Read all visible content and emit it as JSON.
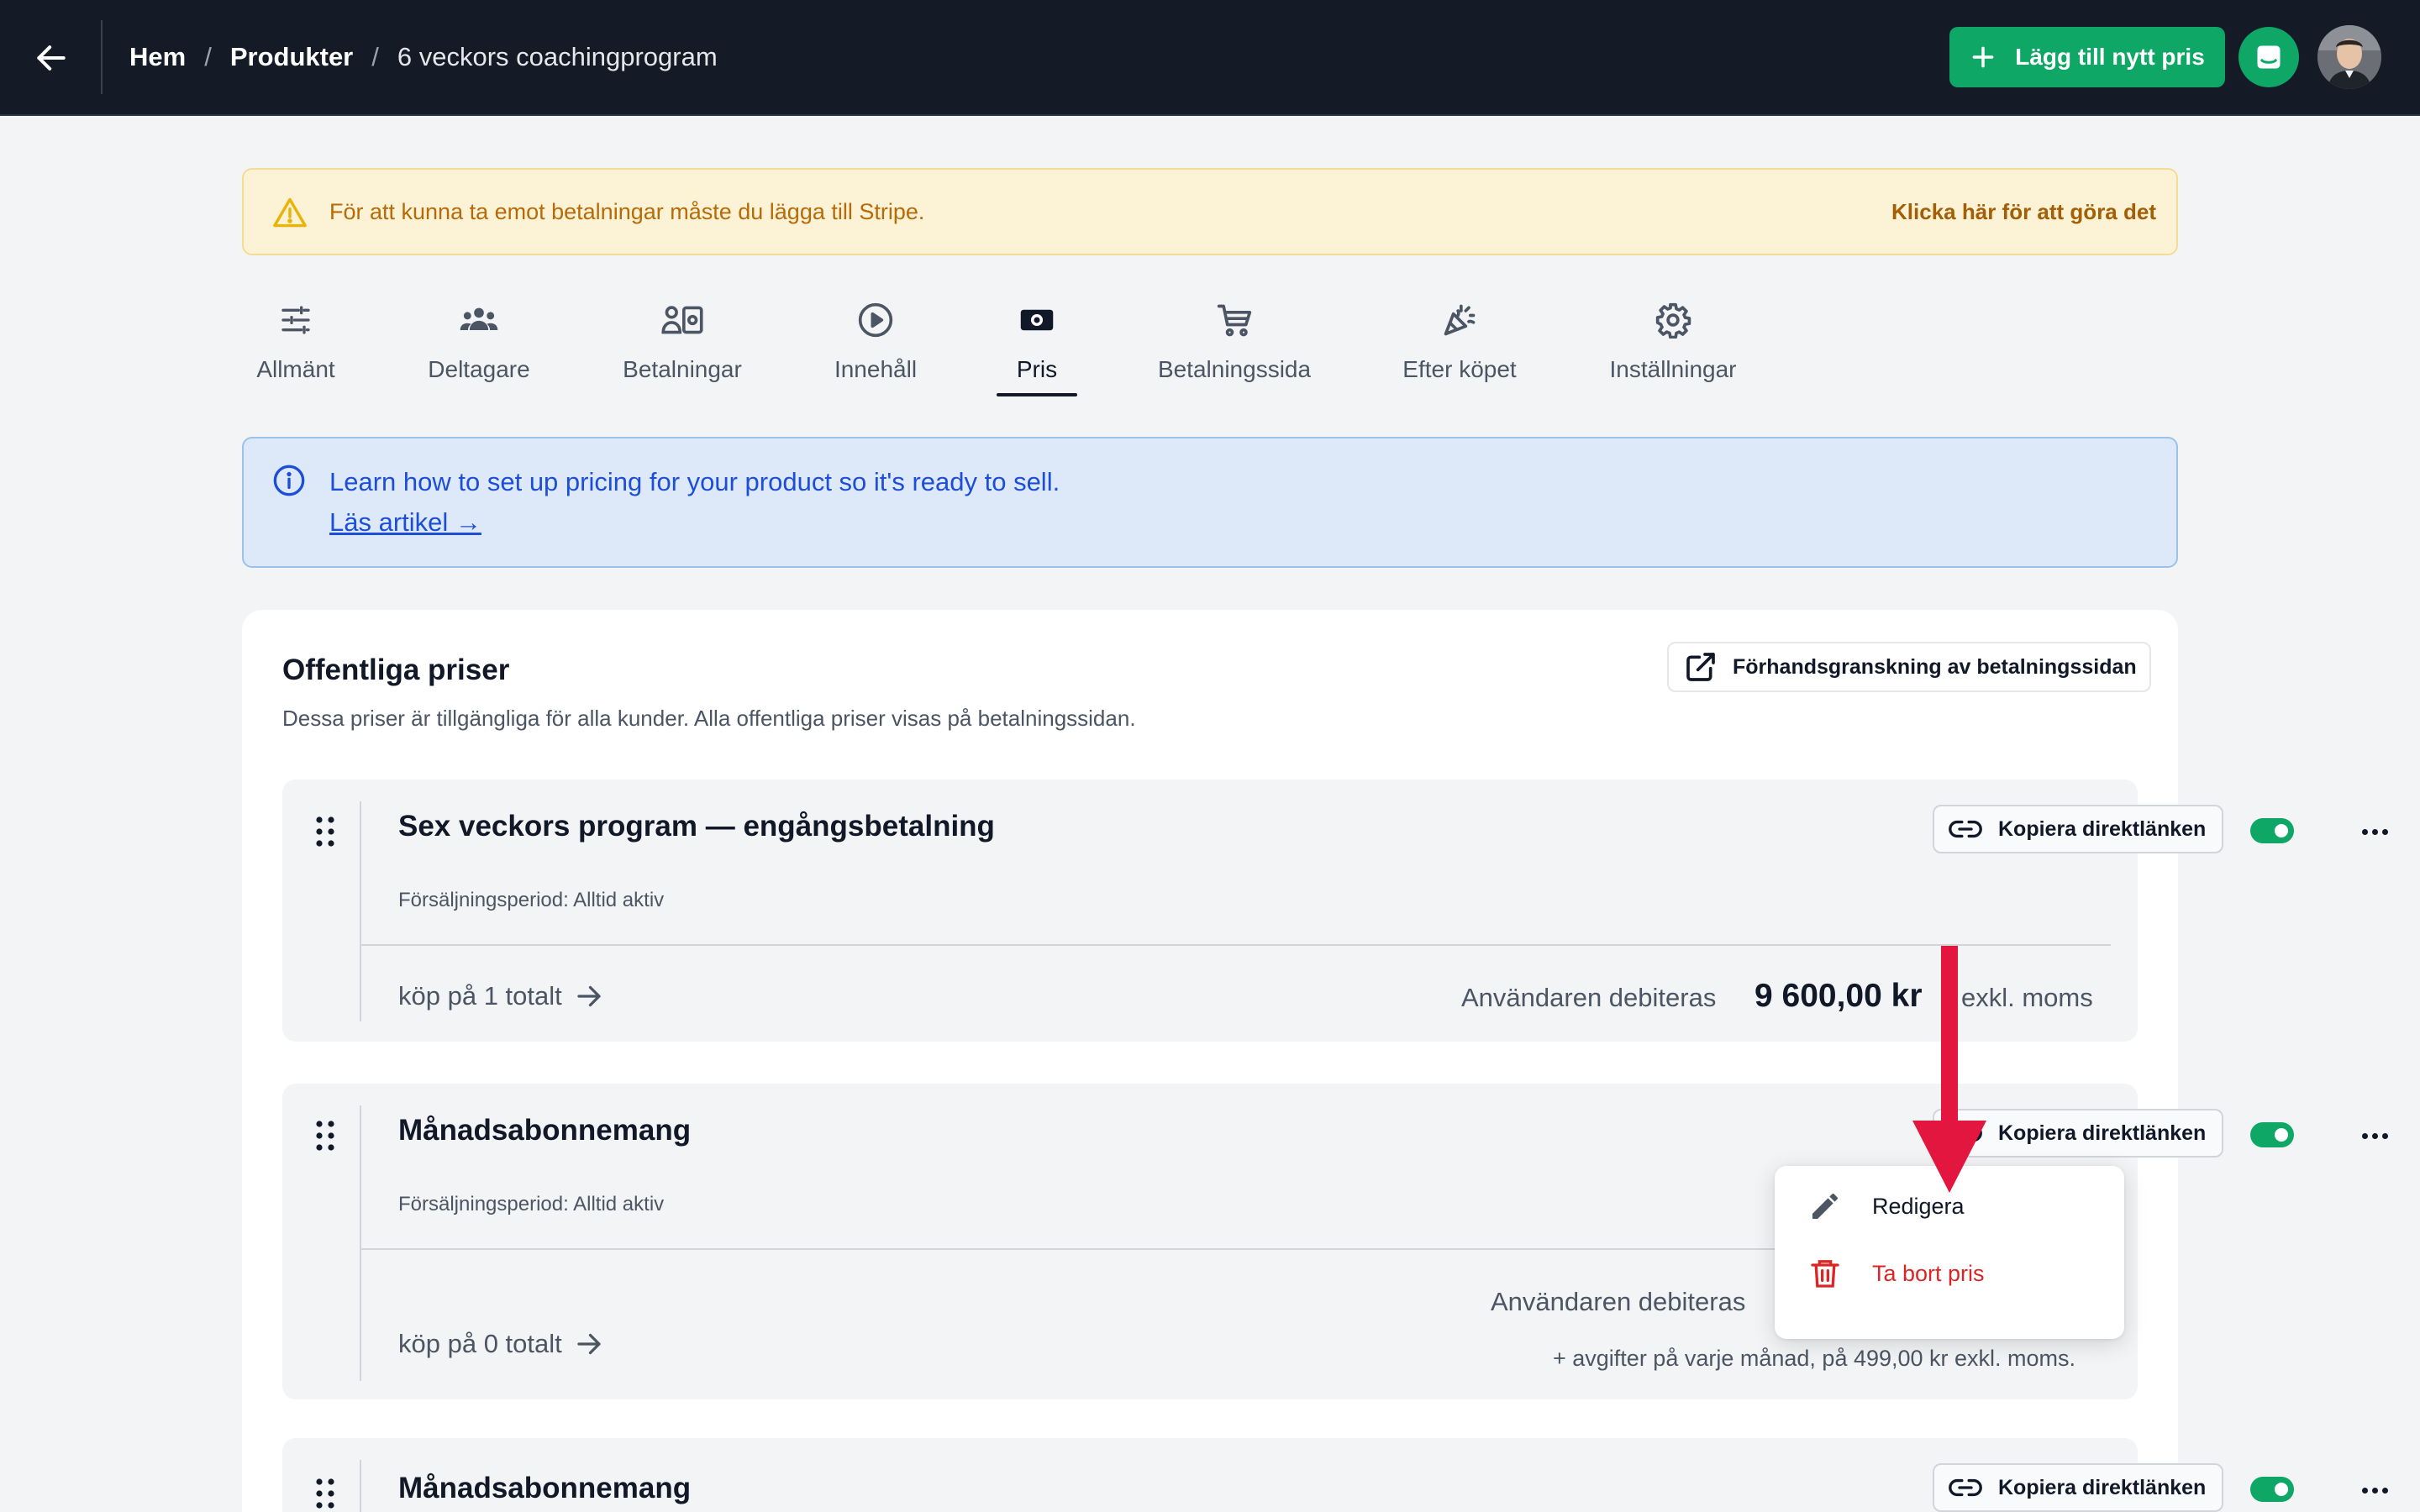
{
  "topbar": {
    "breadcrumb": [
      {
        "label": "Hem"
      },
      {
        "label": "Produkter"
      },
      {
        "label": "6 veckors coachingprogram"
      }
    ],
    "separator": "/",
    "add_price_label": "Lägg till nytt pris",
    "accent_color": "#0ea765"
  },
  "warning": {
    "text": "För att kunna ta emot betalningar måste du lägga till Stripe.",
    "link": "Klicka här för att göra det"
  },
  "tabs": [
    {
      "label": "Allmänt",
      "icon": "sliders-icon"
    },
    {
      "label": "Deltagare",
      "icon": "users-icon"
    },
    {
      "label": "Betalningar",
      "icon": "payments-icon"
    },
    {
      "label": "Innehåll",
      "icon": "play-circle-icon"
    },
    {
      "label": "Pris",
      "icon": "banknote-icon",
      "active": true
    },
    {
      "label": "Betalningssida",
      "icon": "cart-icon"
    },
    {
      "label": "Efter köpet",
      "icon": "party-popper-icon"
    },
    {
      "label": "Inställningar",
      "icon": "gear-icon"
    }
  ],
  "info": {
    "text": "Learn how to set up pricing for your product so it's ready to sell.",
    "link": "Läs artikel →"
  },
  "public_prices": {
    "title": "Offentliga priser",
    "subtitle": "Dessa priser är tillgängliga för alla kunder. Alla offentliga priser visas på betalningssidan.",
    "preview_label": "Förhandsgranskning av betalningssidan",
    "items": [
      {
        "name": "Sex veckors program — engångsbetalning",
        "period": "Försäljningsperiod: Alltid aktiv",
        "copy_label": "Kopiera direktlänken",
        "enabled": true,
        "purchases": "köp på 1 totalt",
        "charge_label": "Användaren debiteras",
        "amount": "9 600,00 kr",
        "suffix": "exkl. moms"
      },
      {
        "name": "Månadsabonnemang",
        "period": "Försäljningsperiod: Alltid aktiv",
        "copy_label": "Kopiera direktlänken",
        "enabled": true,
        "purchases": "köp på 0 totalt",
        "charge_label": "Användaren debiteras",
        "fee_note": "+ avgifter på varje månad, på 499,00 kr exkl. moms."
      },
      {
        "name": "Månadsabonnemang",
        "copy_label": "Kopiera direktlänken",
        "enabled": true
      }
    ]
  },
  "menu": {
    "edit_label": "Redigera",
    "delete_label": "Ta bort pris",
    "delete_color": "#dc2626"
  },
  "annotation": {
    "color": "#e3163f"
  }
}
